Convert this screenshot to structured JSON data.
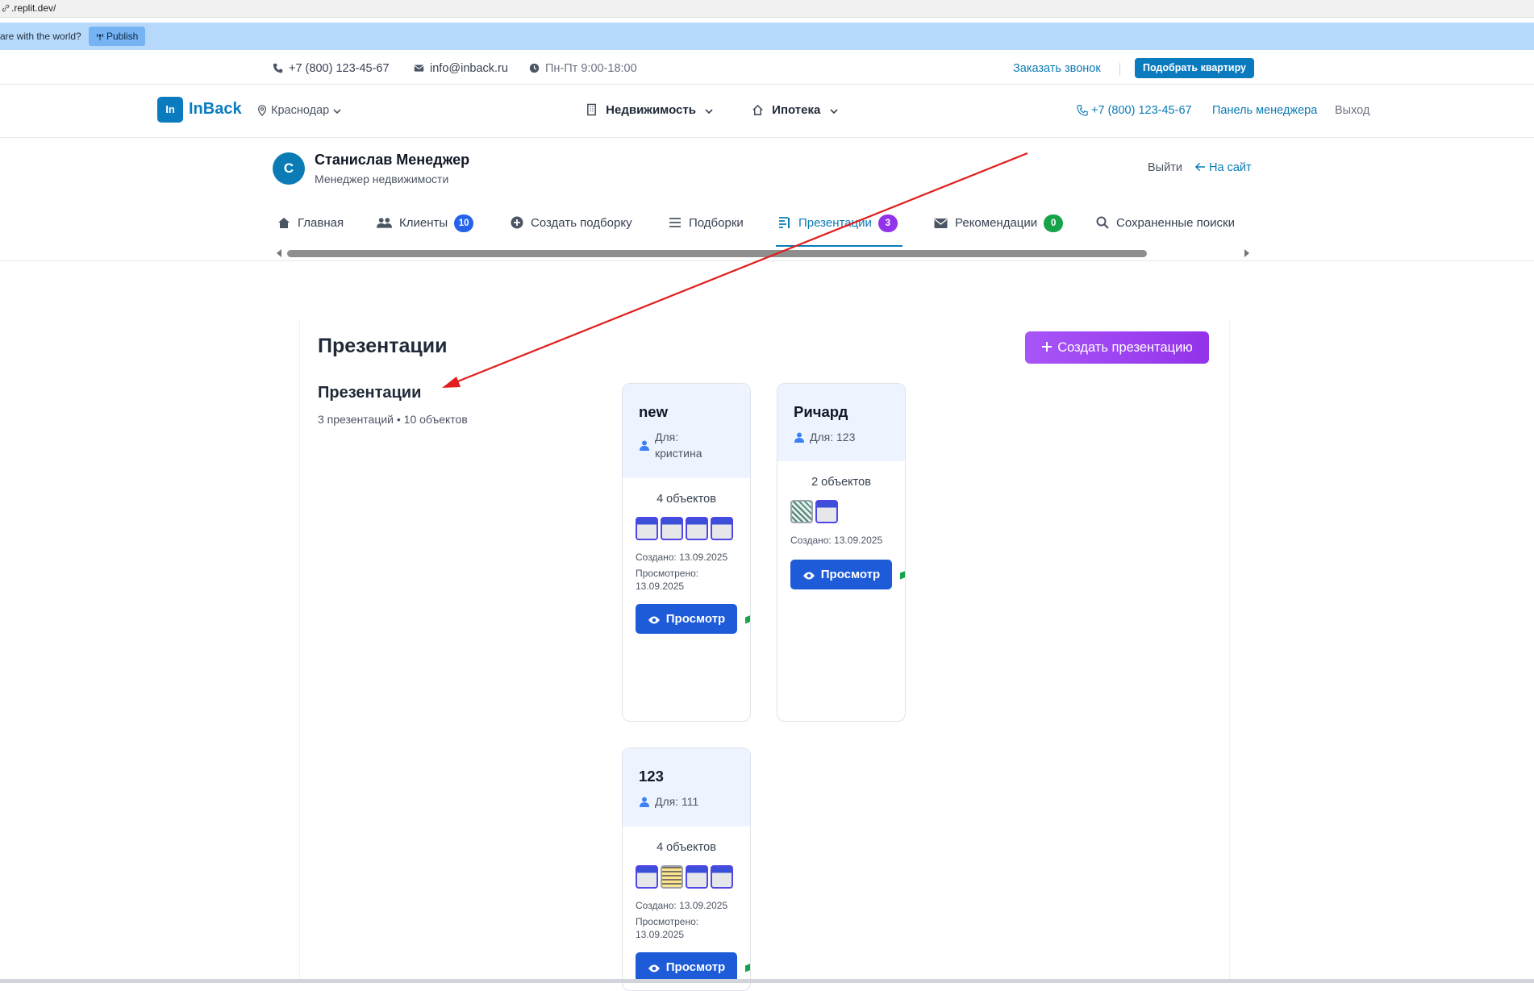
{
  "browser": {
    "url": ".replit.dev/"
  },
  "publish_banner": {
    "text": "are with the world?",
    "button": "Publish"
  },
  "topbar": {
    "phone": "+7 (800) 123-45-67",
    "email": "info@inback.ru",
    "hours": "Пн-Пт 9:00-18:00",
    "callback": "Заказать звонок",
    "pick_apartment": "Подобрать квартиру"
  },
  "header": {
    "logo_mark": "In",
    "logo_text": "InBack",
    "city": "Краснодар",
    "nav": [
      {
        "label": "Недвижимость"
      },
      {
        "label": "Ипотека"
      }
    ],
    "phone": "+7 (800) 123-45-67",
    "manager_panel": "Панель менеджера",
    "logout": "Выход"
  },
  "profile": {
    "initial": "С",
    "name": "Станислав Менеджер",
    "role": "Менеджер недвижимости",
    "exit": "Выйти",
    "to_site": "На сайт"
  },
  "tabs": [
    {
      "label": "Главная"
    },
    {
      "label": "Клиенты",
      "badge": "10"
    },
    {
      "label": "Создать подборку"
    },
    {
      "label": "Подборки"
    },
    {
      "label": "Презентации",
      "badge": "3",
      "active": true
    },
    {
      "label": "Рекомендации",
      "badge": "0"
    },
    {
      "label": "Сохраненные поиски"
    }
  ],
  "colors": {
    "brand": "#0b7bc0",
    "accent_purple": "#9333ea",
    "view_button": "#1d5bd8",
    "badge_blue": "#2563eb",
    "badge_green": "#16a34a",
    "annotation_arrow": "#e11d1d"
  },
  "page": {
    "title": "Презентации",
    "create_button": "Создать презентацию",
    "section_title": "Презентации",
    "summary": "3 презентаций • 10 объектов"
  },
  "cards": [
    {
      "title": "new",
      "for_label": "Для:",
      "for_value": "кристина",
      "count": "4 объектов",
      "created": "Создано: 13.09.2025",
      "viewed_label": "Просмотрено:",
      "viewed_date": "13.09.2025",
      "button": "Просмотр"
    },
    {
      "title": "Ричард",
      "for_label": "Для:",
      "for_value": "123",
      "count": "2 объектов",
      "created": "Создано: 13.09.2025",
      "button": "Просмотр"
    },
    {
      "title": "123",
      "for_label": "Для:",
      "for_value": "111",
      "count": "4 объектов",
      "created": "Создано: 13.09.2025",
      "viewed_label": "Просмотрено:",
      "viewed_date": "13.09.2025",
      "button": "Просмотр"
    }
  ]
}
